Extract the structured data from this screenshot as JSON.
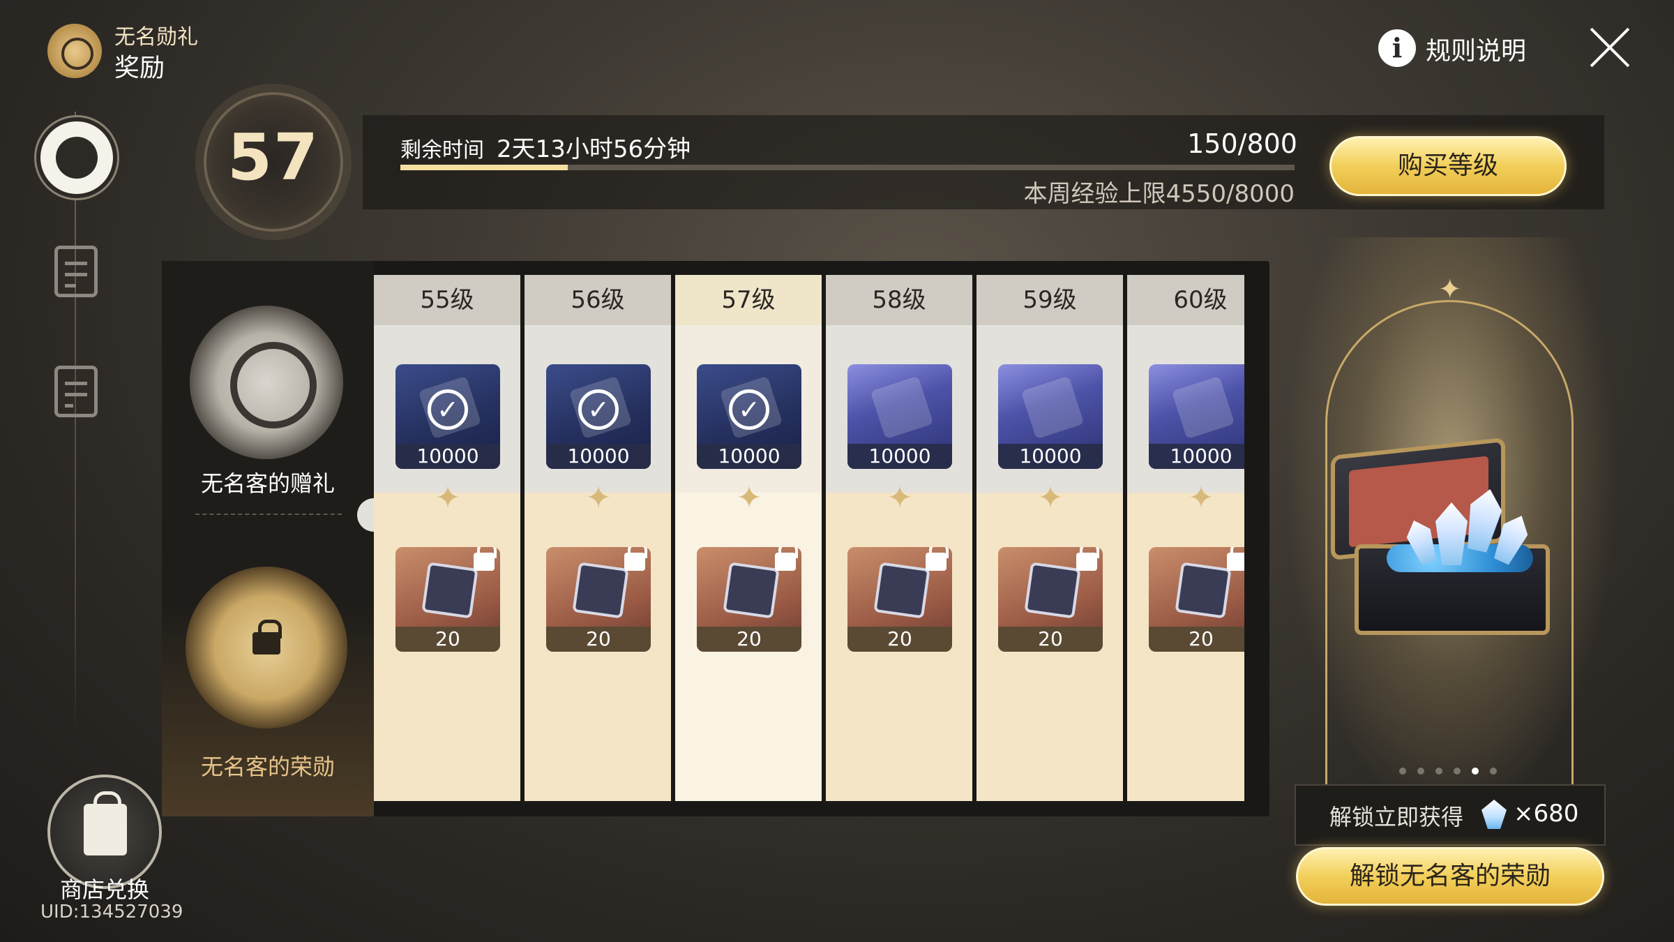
{
  "header": {
    "subtitle": "无名勋礼",
    "title": "奖励",
    "help_label": "规则说明"
  },
  "level": {
    "current": "57",
    "time_label": "剩余时间",
    "time_value": "2天13小时56分钟",
    "exp": "150/800",
    "exp_progress": 0.1875,
    "weekly_cap": "本周经验上限4550/8000",
    "buy_label": "购买等级"
  },
  "sidebar": {
    "items": [
      {
        "icon": "emblem-icon",
        "active": true
      },
      {
        "icon": "clipboard-check-icon",
        "active": false
      },
      {
        "icon": "document-search-icon",
        "active": false
      }
    ],
    "shop_label": "商店兑换",
    "uid": "UID:134527039"
  },
  "tracks": {
    "free_label": "无名客的赠礼",
    "paid_label": "无名客的荣勋"
  },
  "levels": [
    {
      "label": "55级",
      "free_qty": "10000",
      "free_claimed": true,
      "paid_qty": "20",
      "current": false
    },
    {
      "label": "56级",
      "free_qty": "10000",
      "free_claimed": true,
      "paid_qty": "20",
      "current": false
    },
    {
      "label": "57级",
      "free_qty": "10000",
      "free_claimed": true,
      "paid_qty": "20",
      "current": true
    },
    {
      "label": "58级",
      "free_qty": "10000",
      "free_claimed": false,
      "paid_qty": "20",
      "current": false
    },
    {
      "label": "59级",
      "free_qty": "10000",
      "free_claimed": false,
      "paid_qty": "20",
      "current": false
    },
    {
      "label": "60级",
      "free_qty": "10000",
      "free_claimed": false,
      "paid_qty": "20",
      "current": false
    }
  ],
  "preview": {
    "carousel_total": 6,
    "carousel_active": 5,
    "unlock_text": "解锁立即获得",
    "unlock_count": "×680",
    "unlock_button": "解锁无名客的荣勋"
  },
  "colors": {
    "accent_gold": "#f2cf5a",
    "progress_fill": "#f6dea0",
    "paid_label": "#e6c489"
  }
}
